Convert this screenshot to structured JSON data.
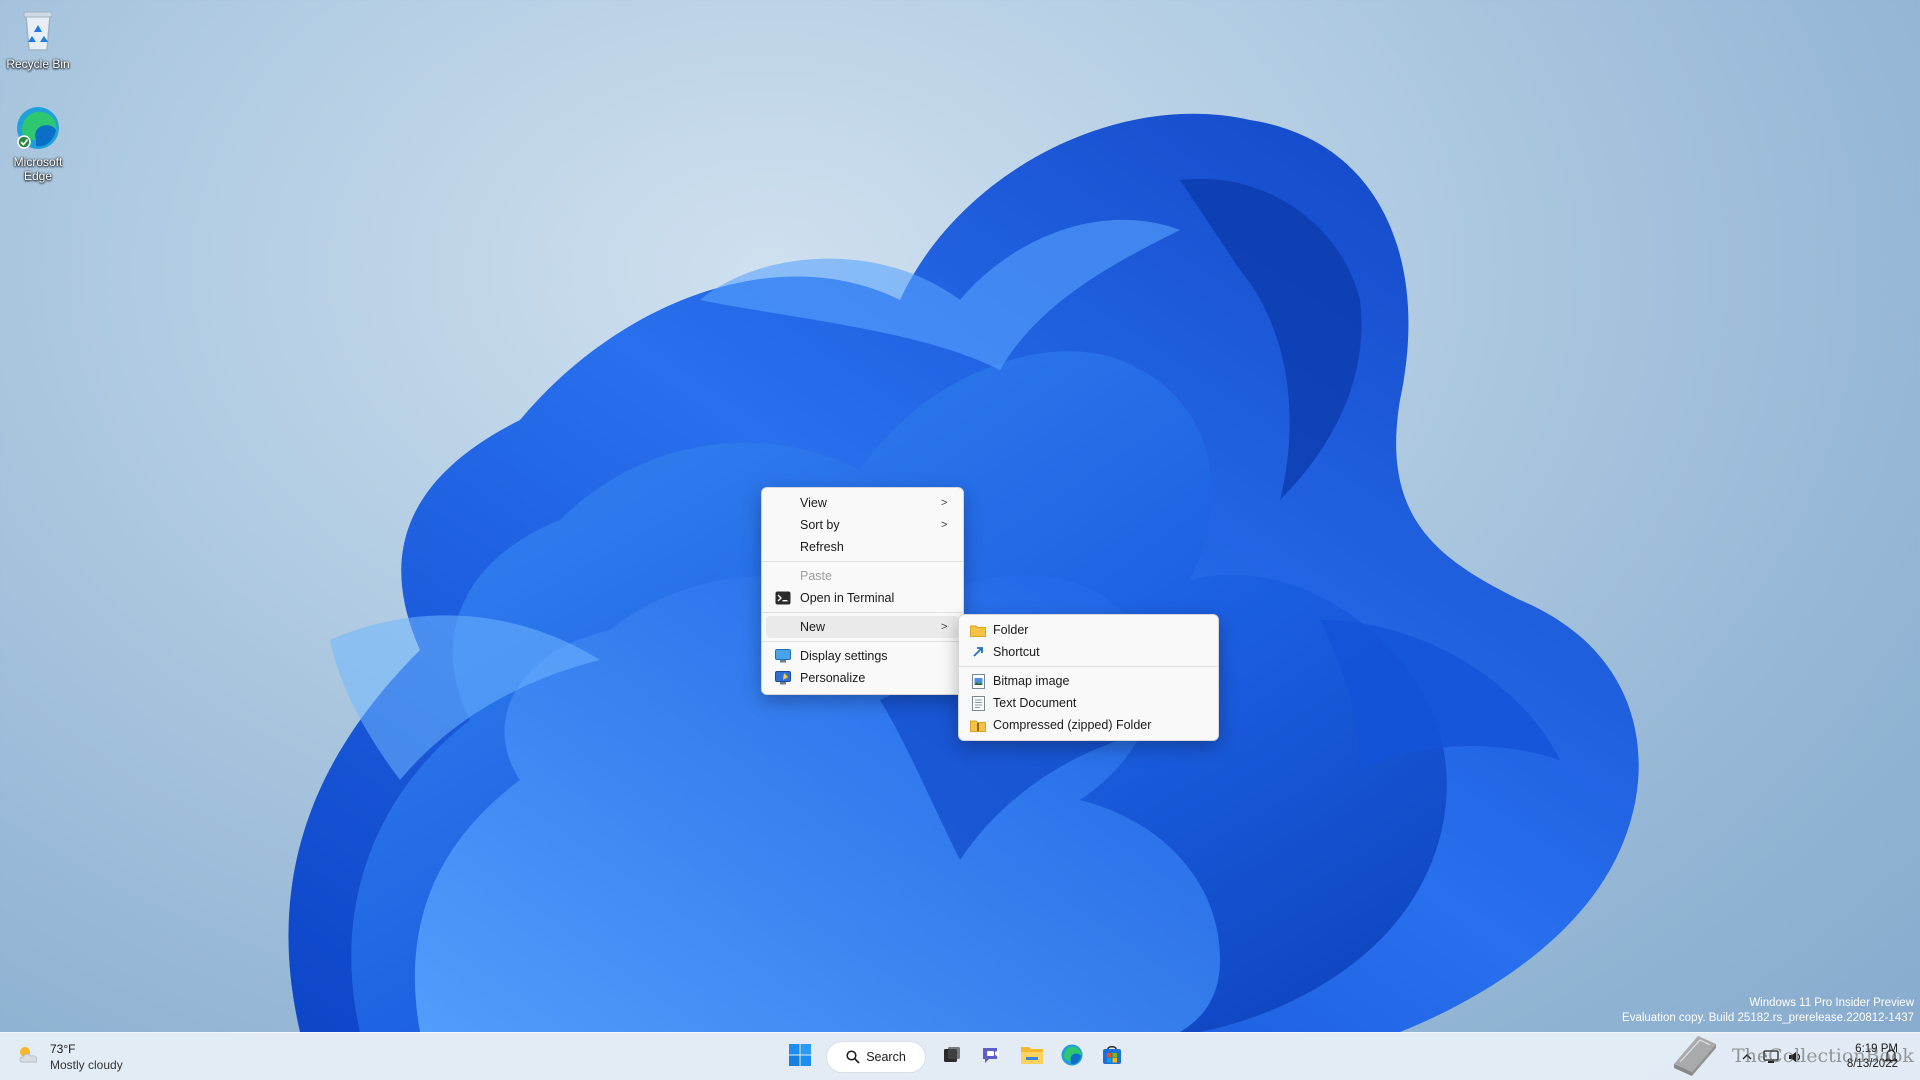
{
  "desktop": {
    "icons": [
      {
        "label": "Recycle Bin",
        "icon": "recycle-bin-icon"
      },
      {
        "label": "Microsoft Edge",
        "icon": "edge-icon"
      }
    ],
    "watermark": {
      "line1": "Windows 11 Pro Insider Preview",
      "line2": "Evaluation copy. Build 25182.rs_prerelease.220812-1437"
    }
  },
  "context_menu": {
    "items": [
      {
        "label": "View",
        "submenu": true
      },
      {
        "label": "Sort by",
        "submenu": true
      },
      {
        "label": "Refresh"
      },
      {
        "label": "Paste",
        "disabled": true
      },
      {
        "label": "Open in Terminal",
        "icon": "terminal-icon"
      },
      {
        "label": "New",
        "submenu": true,
        "active": true
      },
      {
        "label": "Display settings",
        "icon": "display-icon"
      },
      {
        "label": "Personalize",
        "icon": "personalize-icon"
      }
    ],
    "chevron": ">"
  },
  "new_submenu": {
    "items": [
      {
        "label": "Folder",
        "icon": "folder-icon"
      },
      {
        "label": "Shortcut",
        "icon": "shortcut-icon"
      },
      {
        "label": "Bitmap image",
        "icon": "bitmap-icon"
      },
      {
        "label": "Text Document",
        "icon": "text-document-icon"
      },
      {
        "label": "Compressed (zipped) Folder",
        "icon": "zip-folder-icon"
      }
    ]
  },
  "taskbar": {
    "weather": {
      "temp": "73°F",
      "condition": "Mostly cloudy"
    },
    "search_label": "Search",
    "pinned": [
      "start-icon",
      "task-view-icon",
      "teams-chat-icon",
      "file-explorer-icon",
      "edge-icon",
      "store-icon"
    ],
    "clock": {
      "time": "6:19 PM",
      "date": "8/13/2022"
    },
    "brand": "TheCollectionBook"
  },
  "colors": {
    "accent": "#0067c0",
    "menu_bg": "#f9f9f9",
    "taskbar_bg": "#e8f0f8"
  }
}
